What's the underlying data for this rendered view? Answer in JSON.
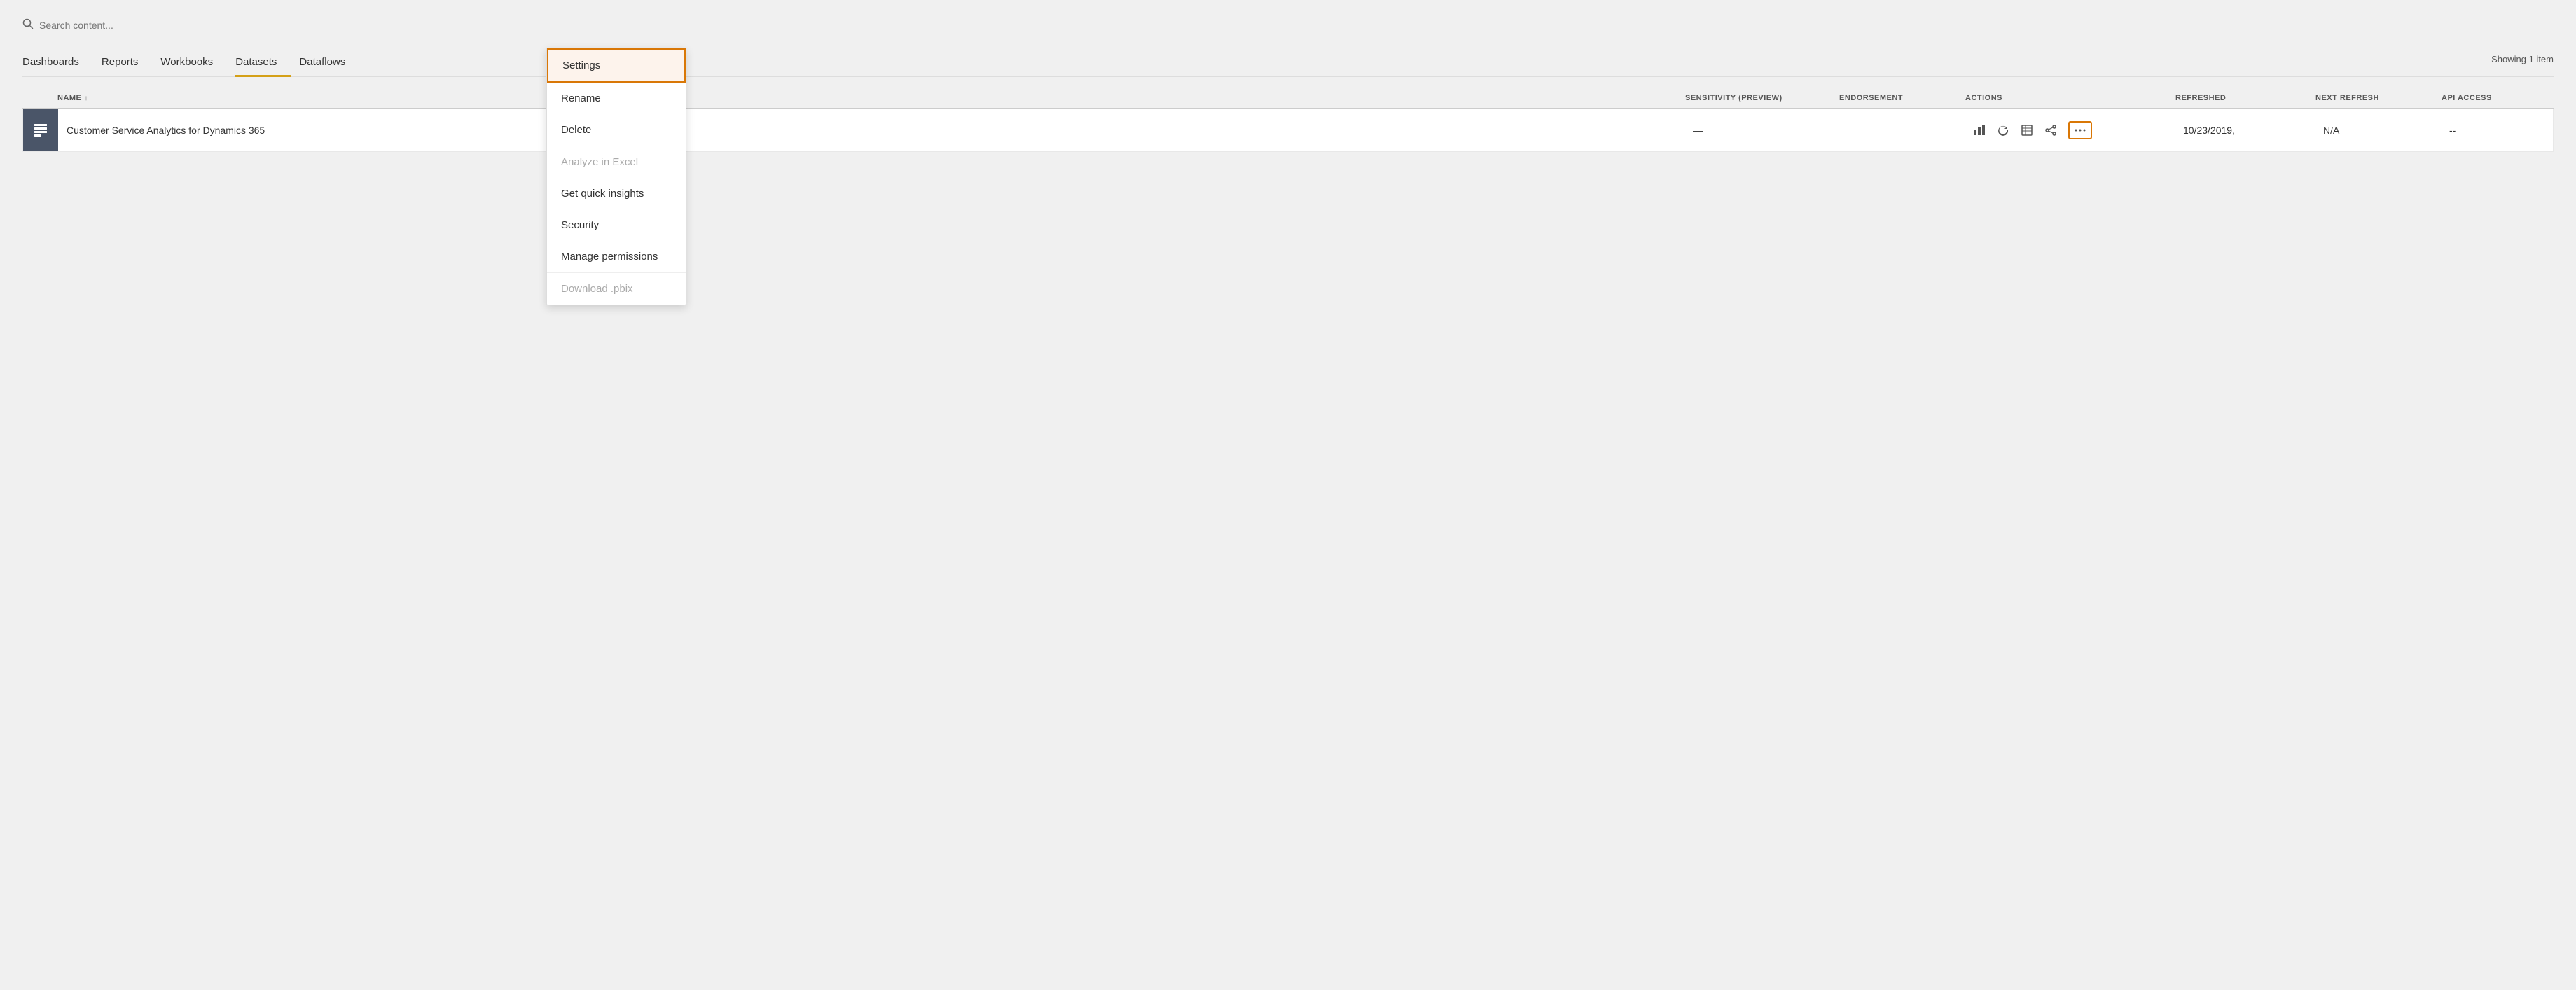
{
  "search": {
    "placeholder": "Search content..."
  },
  "tabs": [
    {
      "id": "dashboards",
      "label": "Dashboards",
      "active": false
    },
    {
      "id": "reports",
      "label": "Reports",
      "active": false
    },
    {
      "id": "workbooks",
      "label": "Workbooks",
      "active": false
    },
    {
      "id": "datasets",
      "label": "Datasets",
      "active": true
    },
    {
      "id": "dataflows",
      "label": "Dataflows",
      "active": false
    }
  ],
  "showing_count": "Showing 1 item",
  "table": {
    "headers": {
      "name": "NAME",
      "sensitivity": "SENSITIVITY (preview)",
      "endorsement": "ENDORSEMENT",
      "actions": "ACTIONS",
      "refreshed": "REFRESHED",
      "next_refresh": "NEXT REFRESH",
      "api_access": "API ACCESS"
    },
    "rows": [
      {
        "name": "Customer Service Analytics for Dynamics 365",
        "sensitivity": "—",
        "endorsement": "",
        "refreshed": "10/23/2019,",
        "next_refresh": "N/A",
        "api_access": "--"
      }
    ]
  },
  "dropdown": {
    "items": [
      {
        "id": "settings",
        "label": "Settings",
        "highlighted": true,
        "disabled": false
      },
      {
        "id": "rename",
        "label": "Rename",
        "highlighted": false,
        "disabled": false
      },
      {
        "id": "delete",
        "label": "Delete",
        "highlighted": false,
        "disabled": false
      },
      {
        "id": "analyze-excel",
        "label": "Analyze in Excel",
        "highlighted": false,
        "disabled": true
      },
      {
        "id": "quick-insights",
        "label": "Get quick insights",
        "highlighted": false,
        "disabled": false
      },
      {
        "id": "security",
        "label": "Security",
        "highlighted": false,
        "disabled": false
      },
      {
        "id": "manage-permissions",
        "label": "Manage permissions",
        "highlighted": false,
        "disabled": false
      },
      {
        "id": "download-pbix",
        "label": "Download .pbix",
        "highlighted": false,
        "disabled": true
      }
    ]
  }
}
